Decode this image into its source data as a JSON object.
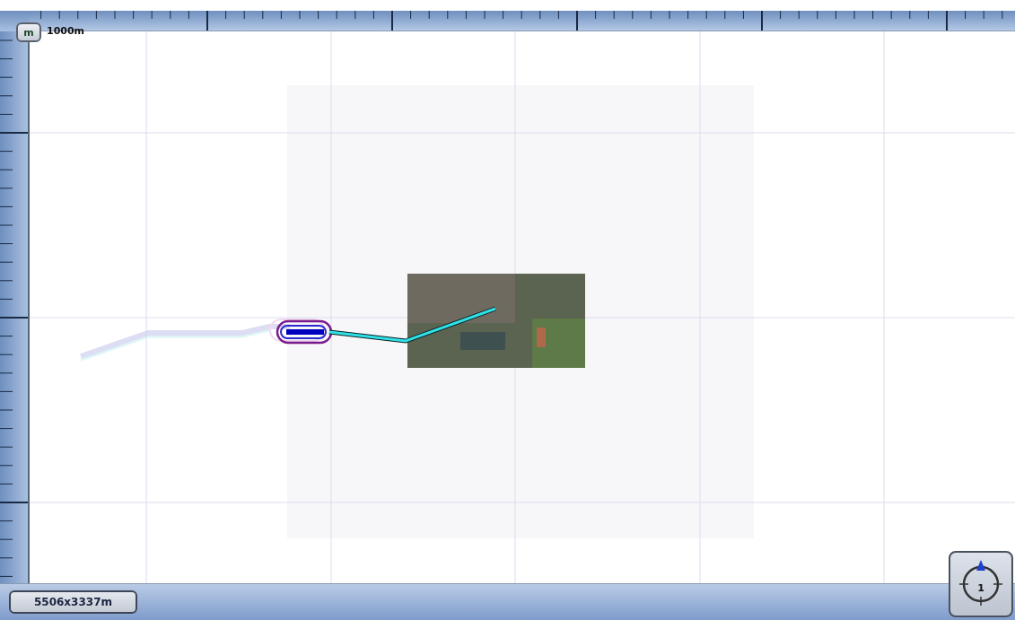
{
  "scale": {
    "unit_button": "m",
    "label": "1000m"
  },
  "status_bar": {
    "dimensions": "5506x3337m"
  },
  "compass": {
    "label": "1"
  }
}
